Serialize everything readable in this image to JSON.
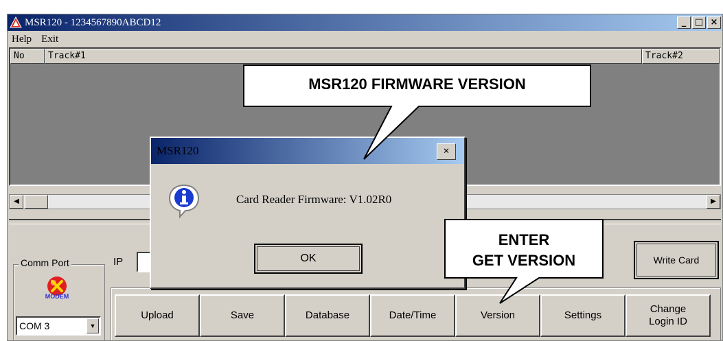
{
  "window": {
    "title": "MSR120  -  1234567890ABCD12",
    "controls": {
      "minimize": "_",
      "maximize": "□",
      "close": "×"
    }
  },
  "menu": {
    "items": [
      "Help",
      "Exit"
    ]
  },
  "table": {
    "columns": [
      "No",
      "Track#1",
      "Track#2"
    ]
  },
  "comm": {
    "group_label": "Comm Port",
    "modem_label": "MODEM",
    "port_value": "COM 3",
    "ip_label": "IP"
  },
  "buttons": {
    "write_card": "Write Card",
    "row": [
      "Upload",
      "Save",
      "Database",
      "Date/Time",
      "Version",
      "Settings",
      "Change\nLogin ID"
    ]
  },
  "dialog": {
    "title": "MSR120",
    "message": "Card Reader Firmware: V1.02R0",
    "ok": "OK",
    "close": "×",
    "icon": "info-icon"
  },
  "callouts": {
    "firmware": "MSR120 FIRMWARE VERSION",
    "enter": "ENTER\nGET VERSION"
  },
  "colors": {
    "titlebar_start": "#0a246a",
    "titlebar_end": "#a6caf0",
    "face": "#d4d0c8",
    "table_bg": "#808080"
  }
}
